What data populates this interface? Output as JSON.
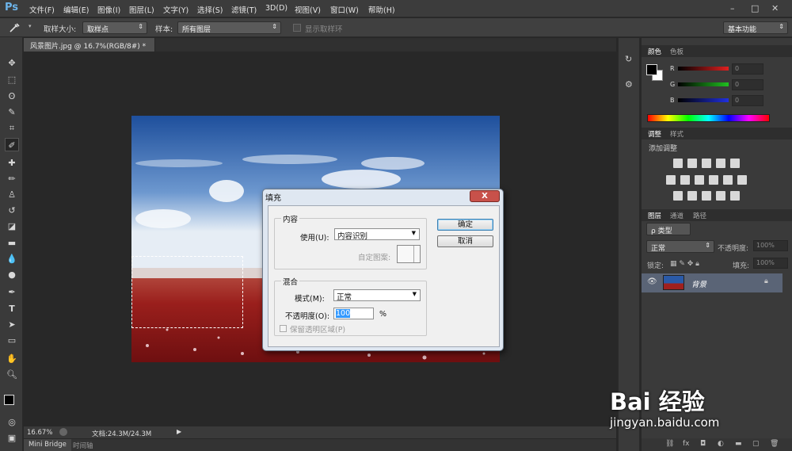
{
  "app": {
    "logo": "Ps"
  },
  "menu": [
    "文件(F)",
    "编辑(E)",
    "图像(I)",
    "图层(L)",
    "文字(Y)",
    "选择(S)",
    "滤镜(T)",
    "3D(D)",
    "视图(V)",
    "窗口(W)",
    "帮助(H)"
  ],
  "window_controls": {
    "minimize": "–",
    "restore": "□",
    "close": "✕"
  },
  "options": {
    "sample_size_label": "取样大小:",
    "sample_size_value": "取样点",
    "sample_label": "样本:",
    "sample_value": "所有图层",
    "show_ring_label": "显示取样环",
    "workspace": "基本功能"
  },
  "document": {
    "tab_title": "风景图片.jpg @ 16.7%(RGB/8#) *",
    "tab_close": "×"
  },
  "status": {
    "zoom": "16.67%",
    "doc_info": "文档:24.3M/24.3M"
  },
  "bottom_tabs": [
    "Mini Bridge",
    "时间轴"
  ],
  "color_panel": {
    "tabs": [
      "颜色",
      "色板"
    ],
    "channels": [
      {
        "label": "R",
        "value": "0",
        "color": "#e02020"
      },
      {
        "label": "G",
        "value": "0",
        "color": "#20c020"
      },
      {
        "label": "B",
        "value": "0",
        "color": "#2030e0"
      }
    ]
  },
  "adjust_panel": {
    "tabs": [
      "调整",
      "样式"
    ],
    "title": "添加调整"
  },
  "layers_panel": {
    "tabs": [
      "图层",
      "通道",
      "路径"
    ],
    "filter": "ρ 类型",
    "blend_mode": "正常",
    "opacity_label": "不透明度:",
    "opacity_value": "100%",
    "lock_label": "锁定:",
    "fill_label": "填充:",
    "fill_value": "100%",
    "layer_name": "背景"
  },
  "dialog": {
    "title": "填充",
    "close": "X",
    "content_group": "内容",
    "use_label": "使用(U):",
    "use_value": "内容识别",
    "custom_pattern_label": "自定图案:",
    "blend_group": "混合",
    "mode_label": "模式(M):",
    "mode_value": "正常",
    "opacity_label": "不透明度(O):",
    "opacity_value": "100",
    "opacity_unit": "%",
    "preserve_label": "保留透明区域(P)",
    "ok": "确定",
    "cancel": "取消"
  },
  "watermark": {
    "brand": "Bai  经验",
    "url": "jingyan.baidu.com"
  }
}
